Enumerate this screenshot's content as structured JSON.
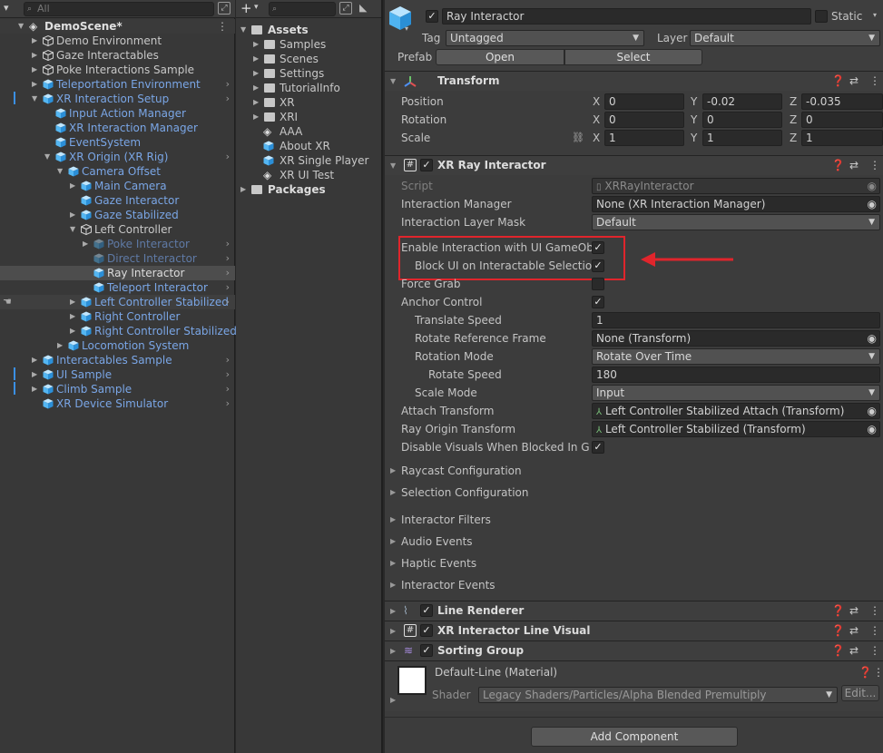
{
  "hierarchy": {
    "search_placeholder": "All",
    "scene": "DemoScene*",
    "items": [
      {
        "label": "Demo Environment"
      },
      {
        "label": "Gaze Interactables"
      },
      {
        "label": "Poke Interactions Sample"
      },
      {
        "label": "Teleportation Environment"
      },
      {
        "label": "XR Interaction Setup"
      },
      {
        "label": "Input Action Manager"
      },
      {
        "label": "XR Interaction Manager"
      },
      {
        "label": "EventSystem"
      },
      {
        "label": "XR Origin (XR Rig)"
      },
      {
        "label": "Camera Offset"
      },
      {
        "label": "Main Camera"
      },
      {
        "label": "Gaze Interactor"
      },
      {
        "label": "Gaze Stabilized"
      },
      {
        "label": "Left Controller"
      },
      {
        "label": "Poke Interactor"
      },
      {
        "label": "Direct Interactor"
      },
      {
        "label": "Ray Interactor"
      },
      {
        "label": "Teleport Interactor"
      },
      {
        "label": "Left Controller Stabilized"
      },
      {
        "label": "Right Controller"
      },
      {
        "label": "Right Controller Stabilized"
      },
      {
        "label": "Locomotion System"
      },
      {
        "label": "Interactables Sample"
      },
      {
        "label": "UI Sample"
      },
      {
        "label": "Climb Sample"
      },
      {
        "label": "XR Device Simulator"
      }
    ]
  },
  "project": {
    "root": "Assets",
    "items": [
      {
        "label": "Samples"
      },
      {
        "label": "Scenes"
      },
      {
        "label": "Settings"
      },
      {
        "label": "TutorialInfo"
      },
      {
        "label": "XR"
      },
      {
        "label": "XRI"
      },
      {
        "label": "AAA"
      },
      {
        "label": "About XR"
      },
      {
        "label": "XR Single Player"
      },
      {
        "label": "XR UI Test"
      }
    ],
    "packages": "Packages"
  },
  "inspector": {
    "object_name": "Ray Interactor",
    "static_label": "Static",
    "tag_label": "Tag",
    "tag_value": "Untagged",
    "layer_label": "Layer",
    "layer_value": "Default",
    "prefab_label": "Prefab",
    "open_label": "Open",
    "select_label": "Select",
    "transform": {
      "title": "Transform",
      "position_label": "Position",
      "rotation_label": "Rotation",
      "scale_label": "Scale",
      "x": "X",
      "y": "Y",
      "z": "Z",
      "position": [
        "0",
        "-0.02",
        "-0.035"
      ],
      "rotation": [
        "0",
        "0",
        "0"
      ],
      "scale": [
        "1",
        "1",
        "1"
      ]
    },
    "ray": {
      "title": "XR Ray Interactor",
      "script_label": "Script",
      "script_value": "XRRayInteractor",
      "im_label": "Interaction Manager",
      "im_value": "None (XR Interaction Manager)",
      "ilm_label": "Interaction Layer Mask",
      "ilm_value": "Default",
      "enable_ui_label": "Enable Interaction with UI GameObjects",
      "block_ui_label": "Block UI on Interactable Selection",
      "force_grab_label": "Force Grab",
      "anchor_label": "Anchor Control",
      "translate_label": "Translate Speed",
      "translate_value": "1",
      "rrf_label": "Rotate Reference Frame",
      "rrf_value": "None (Transform)",
      "rot_mode_label": "Rotation Mode",
      "rot_mode_value": "Rotate Over Time",
      "rot_speed_label": "Rotate Speed",
      "rot_speed_value": "180",
      "scale_mode_label": "Scale Mode",
      "scale_mode_value": "Input",
      "attach_label": "Attach Transform",
      "attach_value": "Left Controller Stabilized Attach (Transform)",
      "origin_label": "Ray Origin Transform",
      "origin_value": "Left Controller Stabilized (Transform)",
      "disable_vis_label": "Disable Visuals When Blocked In Group",
      "sections": [
        "Raycast Configuration",
        "Selection Configuration",
        "Interactor Filters",
        "Audio Events",
        "Haptic Events",
        "Interactor Events"
      ]
    },
    "components": [
      "Line Renderer",
      "XR Interactor Line Visual",
      "Sorting Group"
    ],
    "material": {
      "name": "Default-Line (Material)",
      "shader_label": "Shader",
      "shader_value": "Legacy Shaders/Particles/Alpha Blended Premultiply",
      "edit_label": "Edit..."
    },
    "add_component": "Add Component"
  },
  "colors": {
    "highlight": "#e0252c",
    "accent": "#7aa6e6"
  }
}
